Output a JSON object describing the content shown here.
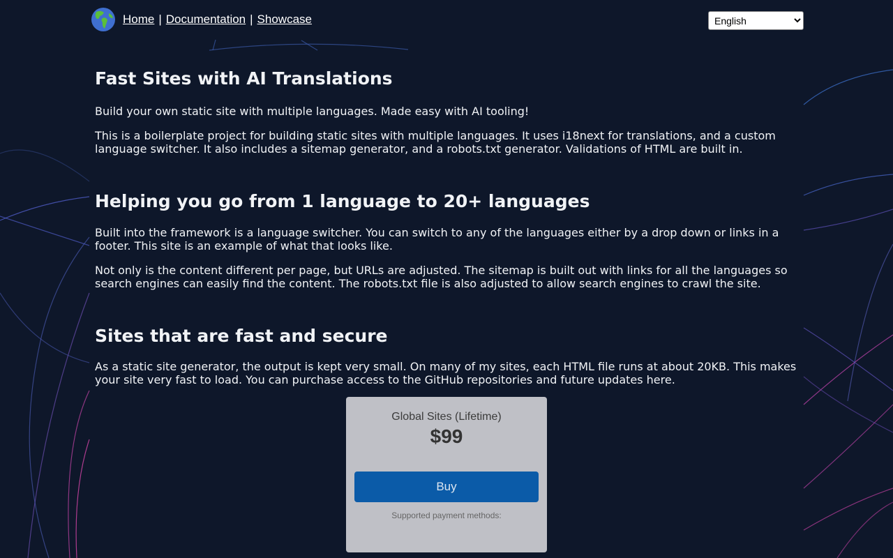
{
  "nav": {
    "links": [
      "Home",
      "Documentation",
      "Showcase"
    ],
    "separator": "|",
    "language": "English",
    "language_options": [
      "English"
    ]
  },
  "sections": [
    {
      "title": "Fast Sites with AI Translations",
      "paragraphs": [
        "Build your own static site with multiple languages. Made easy with AI tooling!",
        "This is a boilerplate project for building static sites with multiple languages. It uses i18next for translations, and a custom language switcher. It also includes a sitemap generator, and a robots.txt generator. Validations of HTML are built in."
      ]
    },
    {
      "title": "Helping you go from 1 language to 20+ languages",
      "paragraphs": [
        "Built into the framework is a language switcher. You can switch to any of the languages either by a drop down or links in a footer. This site is an example of what that looks like.",
        "Not only is the content different per page, but URLs are adjusted. The sitemap is built out with links for all the languages so search engines can easily find the content. The robots.txt file is also adjusted to allow search engines to crawl the site."
      ]
    },
    {
      "title": "Sites that are fast and secure",
      "paragraphs": [
        "As a static site generator, the output is kept very small. On many of my sites, each HTML file runs at about 20KB. This makes your site very fast to load. You can purchase access to the GitHub repositories and future updates here."
      ]
    }
  ],
  "pricing": {
    "plan": "Global Sites (Lifetime)",
    "price": "$99",
    "button": "Buy",
    "note": "Supported payment methods:"
  },
  "colors": {
    "background": "#0e172a",
    "buy_button": "#0b5ba8",
    "card": "#bfc0c6"
  },
  "icons": {
    "logo": "globe-icon",
    "select": "chevron-down-icon"
  }
}
